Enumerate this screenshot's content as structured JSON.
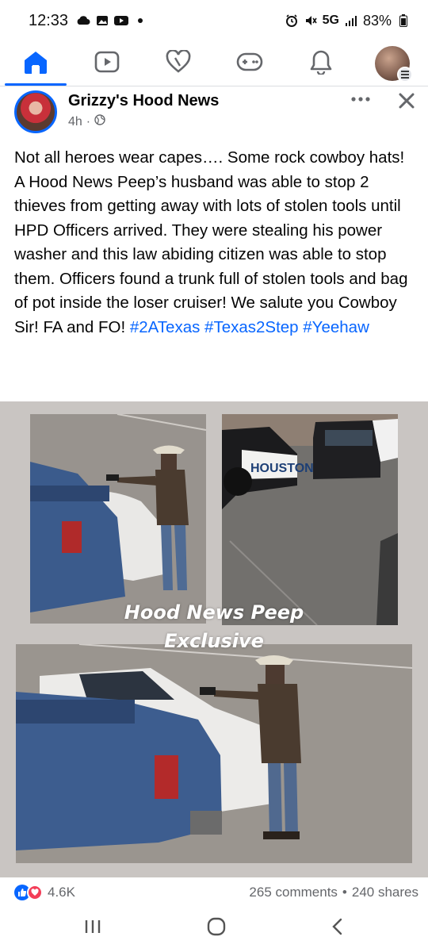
{
  "status_bar": {
    "time": "12:33",
    "network": "5G",
    "battery": "83%",
    "left_icons": [
      "cloud-icon",
      "gallery-icon",
      "youtube-icon",
      "dot-icon"
    ],
    "right_icons": [
      "alarm-clock-icon",
      "mute-icon",
      "signal-icon",
      "battery-icon"
    ]
  },
  "nav": {
    "items": [
      {
        "name": "home",
        "icon": "home-icon",
        "active": true
      },
      {
        "name": "video",
        "icon": "video-icon",
        "active": false
      },
      {
        "name": "dating",
        "icon": "heart-icon",
        "active": false
      },
      {
        "name": "gaming",
        "icon": "gamepad-icon",
        "active": false
      },
      {
        "name": "notifications",
        "icon": "bell-icon",
        "active": false
      },
      {
        "name": "menu",
        "icon": "profile-avatar",
        "active": false
      }
    ],
    "accent": "#0866ff"
  },
  "post": {
    "page_name": "Grizzy's Hood News",
    "time": "4h",
    "separator": "·",
    "audience_icon": "globe-icon",
    "text": "Not all heroes wear capes…. Some rock cowboy hats! A Hood News Peep’s husband was able to stop 2 thieves from getting away with lots of stolen tools until HPD Officers arrived. They were stealing his power washer and this law abiding citizen was able to stop them. Officers found a trunk full of stolen tools and bag of pot inside the loser cruiser! We salute you Cowboy Sir! FA and FO!",
    "hashtags": "#2ATexas #Texas2Step #Yeehaw",
    "image_caption_line1": "Hood News Peep",
    "image_caption_line2": "Exclusive",
    "police_car_text": "HOUSTON POL",
    "reactions_count": "4.6K",
    "comments": "265 comments",
    "dot": "•",
    "shares": "240 shares"
  },
  "colors": {
    "link": "#0866ff",
    "secondary_text": "#65676b",
    "like": "#0866ff",
    "love": "#f33e58"
  }
}
